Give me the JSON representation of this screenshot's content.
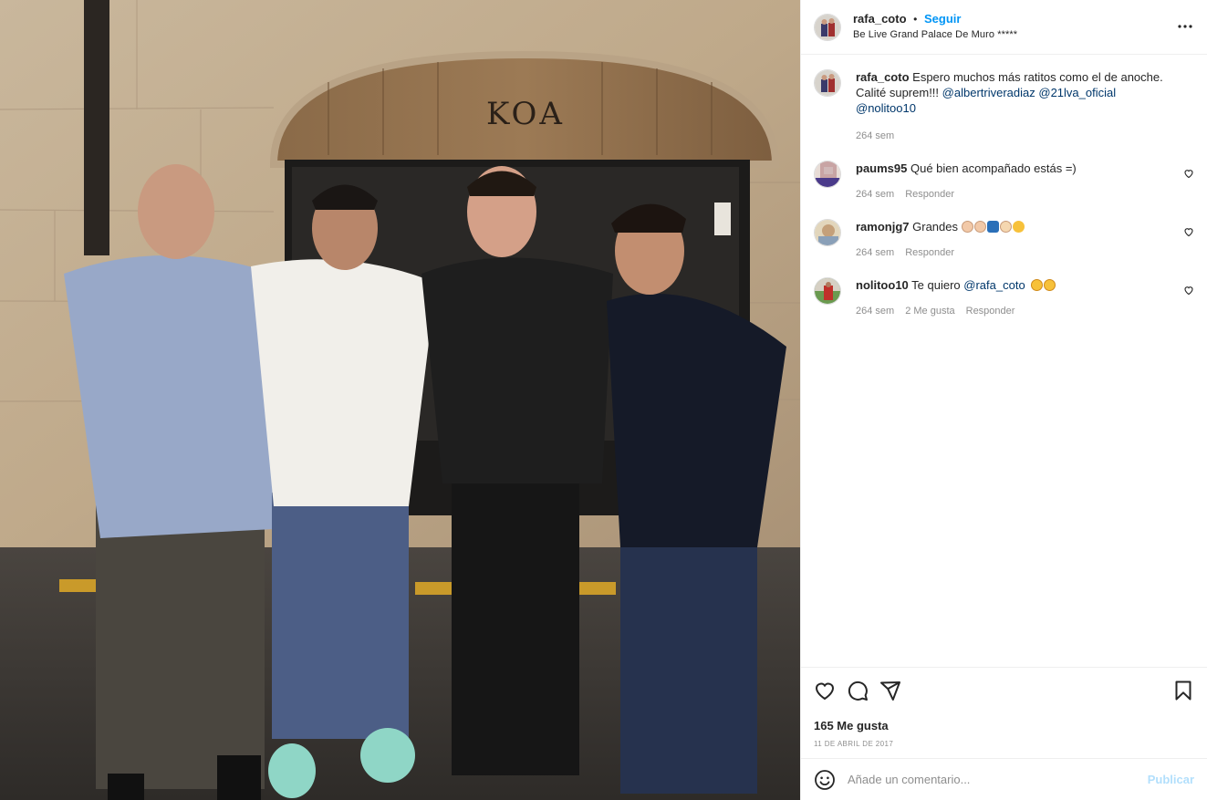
{
  "post": {
    "username": "rafa_coto",
    "separator": "•",
    "follow_label": "Seguir",
    "location": "Be Live Grand Palace De Muro *****",
    "photo_sign_text": "KOA"
  },
  "caption": {
    "username": "rafa_coto",
    "text": "Espero muchos más ratitos como el de anoche. Calité suprem!!!",
    "mentions": [
      "@albertriveradiaz",
      "@21lva_oficial",
      "@nolitoo10"
    ],
    "time": "264 sem"
  },
  "comments": [
    {
      "username": "paums95",
      "text": "Qué bien acompañado estás =)",
      "time": "264 sem",
      "likes": "",
      "reply_label": "Responder",
      "avatar_color": "#5a4a8a"
    },
    {
      "username": "ramonjg7",
      "text": "Grandes",
      "emojis": [
        "clap-emoji",
        "clap-emoji",
        "blue-square-emoji",
        "ok-hand-emoji",
        "kiss-emoji"
      ],
      "time": "264 sem",
      "likes": "",
      "reply_label": "Responder",
      "avatar_color": "#b8a070"
    },
    {
      "username": "nolitoo10",
      "text": "Te quiero",
      "mention": "@rafa_coto",
      "emojis": [
        "tongue-emoji",
        "tongue-emoji"
      ],
      "time": "264 sem",
      "likes": "2 Me gusta",
      "reply_label": "Responder",
      "avatar_color": "#c0302a"
    }
  ],
  "actions": {
    "likes": "165 Me gusta",
    "date": "11 DE ABRIL DE 2017",
    "like_icon": "heart-icon",
    "comment_icon": "comment-icon",
    "share_icon": "share-icon",
    "save_icon": "bookmark-icon"
  },
  "add_comment": {
    "placeholder": "Añade un comentario...",
    "publish_label": "Publicar"
  },
  "colors": {
    "link": "#0095f6",
    "mention": "#00376b",
    "muted": "#8e8e8e",
    "publish_disabled": "#b2dffc"
  }
}
